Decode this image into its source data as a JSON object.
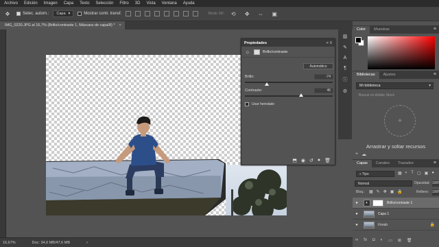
{
  "menu": [
    "Archivo",
    "Edición",
    "Imagen",
    "Capa",
    "Texto",
    "Selección",
    "Filtro",
    "3D",
    "Vista",
    "Ventana",
    "Ayuda"
  ],
  "options": {
    "auto_select_label": "Selec. autom.:",
    "auto_select_value": "Capa",
    "show_transform_label": "Mostrar contr. transf.",
    "mode_3d_label": "Modo 3D:"
  },
  "document": {
    "tab_title": "IMG_0220.JPG al 16,7% (Brillo/contraste 1, Máscara de capa/8) *",
    "close": "×"
  },
  "status": {
    "zoom": "16,67%",
    "doc_info": "Doc: 34,6 MB/47,6 MB",
    "arrow": "›"
  },
  "properties": {
    "title": "Propiedades",
    "subtitle": "Brillo/contraste",
    "auto_button": "Automático",
    "brightness_label": "Brillo:",
    "brightness_value": "-74",
    "brightness_level": -74,
    "brightness_range": [
      -150,
      150
    ],
    "contrast_label": "Contraste:",
    "contrast_value": "46",
    "contrast_level": 46,
    "contrast_range": [
      -50,
      100
    ],
    "legacy_label": "Usar heredado",
    "collapse": "»",
    "menu": "≡"
  },
  "color_panel": {
    "tabs": [
      "Color",
      "Muestras"
    ],
    "fg_color": "#000000",
    "bg_color": "#ffffff"
  },
  "library_panel": {
    "tabs": [
      "Bibliotecas",
      "Ajustes"
    ],
    "library_name": "Mi biblioteca",
    "search_placeholder": "Buscar en Adobe Stock",
    "drop_text": "Arrastrar y soltar recursos"
  },
  "layers_panel": {
    "tabs": [
      "Capas",
      "Canales",
      "Trazados"
    ],
    "filter_label": "Tipo",
    "blend_mode": "Normal",
    "opacity_label": "Opacidad:",
    "opacity_value": "100%",
    "lock_label": "Bloq.:",
    "fill_label": "Relleno:",
    "fill_value": "100%",
    "layers": [
      {
        "name": "Brillo/contraste 1",
        "selected": true
      },
      {
        "name": "Capa 1",
        "selected": false
      },
      {
        "name": "Fondo",
        "selected": false
      }
    ]
  }
}
